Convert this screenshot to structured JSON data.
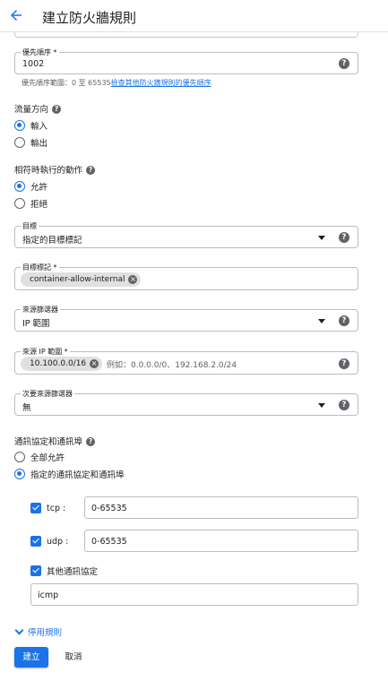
{
  "header": {
    "title": "建立防火牆規則"
  },
  "priority": {
    "label": "優先順序 *",
    "value": "1002",
    "hint": "優先順序範圍：0 至 65535",
    "hint_link": "檢查其他防火牆規則的優先順序"
  },
  "direction": {
    "title": "流量方向",
    "options": [
      "輸入",
      "輸出"
    ],
    "selected": "輸入"
  },
  "action": {
    "title": "相符時執行的動作",
    "options": [
      "允許",
      "拒絕"
    ],
    "selected": "允許"
  },
  "target": {
    "label": "目標",
    "value": "指定的目標標記"
  },
  "target_tags": {
    "label": "目標標記 *",
    "chip": "container-allow-internal"
  },
  "source_filter": {
    "label": "來源篩選器",
    "value": "IP 範圍"
  },
  "source_ip": {
    "label": "來源 IP 範圍 *",
    "chip": "10.100.0.0/16",
    "placeholder": "例如：0.0.0.0/0、192.168.2.0/24"
  },
  "second_filter": {
    "label": "次要來源篩選器",
    "value": "無"
  },
  "protocols": {
    "title": "通訊協定和通訊埠",
    "options": [
      "全部允許",
      "指定的通訊協定和通訊埠"
    ],
    "selected": "指定的通訊協定和通訊埠",
    "tcp_label": "tcp :",
    "tcp_value": "0-65535",
    "udp_label": "udp :",
    "udp_value": "0-65535",
    "other_label": "其他通訊協定",
    "other_value": "icmp"
  },
  "toggle_label": "停用規則",
  "buttons": {
    "create": "建立",
    "cancel": "取消"
  },
  "colors": {
    "accent": "#1a73e8",
    "text": "#202124",
    "secondary": "#5f6368",
    "border": "#bdbdbd"
  }
}
